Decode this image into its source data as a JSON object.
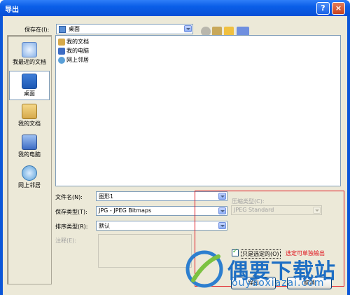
{
  "window": {
    "title": "导出",
    "help_glyph": "?",
    "close_glyph": "×"
  },
  "save_in": {
    "label": "保存在(I):",
    "value": "桌面"
  },
  "places": [
    {
      "label": "我最近的文档",
      "icon": "recent-documents-icon"
    },
    {
      "label": "桌面",
      "icon": "desktop-icon",
      "selected": true
    },
    {
      "label": "我的文档",
      "icon": "my-documents-icon"
    },
    {
      "label": "我的电脑",
      "icon": "my-computer-icon"
    },
    {
      "label": "网上邻居",
      "icon": "network-places-icon"
    }
  ],
  "file_items": [
    {
      "name": "我的文档",
      "icon": "my-documents-icon"
    },
    {
      "name": "我的电脑",
      "icon": "my-computer-icon"
    },
    {
      "name": "网上邻居",
      "icon": "network-places-icon"
    }
  ],
  "form": {
    "filename_label": "文件名(N):",
    "filename_value": "图形1",
    "filetype_label": "保存类型(T):",
    "filetype_value": "JPG - JPEG Bitmaps",
    "sort_label": "排序类型(R):",
    "sort_value": "默认",
    "comment_label": "注释(E):",
    "compression_label": "压缩类型(C):",
    "compression_value": "JPEG Standard"
  },
  "options": {
    "selected_only_label": "只是选定的(O)",
    "annotation": "选定可单独输出",
    "selected_only_checked": true
  },
  "buttons": {
    "export": "导出",
    "cancel": "取消"
  },
  "watermark": {
    "brand": "偶要下载站",
    "url": "ouyaoxiazai.com"
  },
  "colors": {
    "titlebar": "#0a5ee8",
    "annotation_red": "#e0101a",
    "watermark_blue": "#1e6fc4"
  }
}
